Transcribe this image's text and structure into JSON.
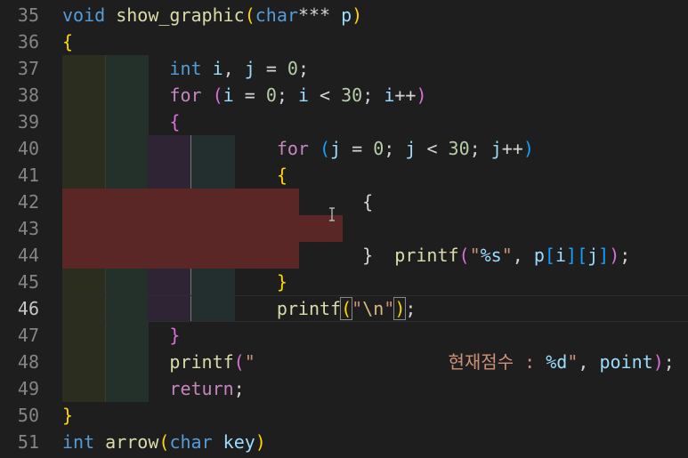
{
  "editor": {
    "active_line": "46",
    "lines": [
      {
        "num": "35",
        "tokens": [
          {
            "t": "void",
            "c": "kw"
          },
          {
            "t": " "
          },
          {
            "t": "show_graphic",
            "c": "fn"
          },
          {
            "t": "(",
            "c": "b1"
          },
          {
            "t": "char",
            "c": "kw"
          },
          {
            "t": "*** "
          },
          {
            "t": "p",
            "c": "var"
          },
          {
            "t": ")",
            "c": "b1"
          }
        ]
      },
      {
        "num": "36",
        "tokens": [
          {
            "t": "{",
            "c": "b1"
          }
        ]
      },
      {
        "num": "37",
        "tokens": [
          {
            "t": "          "
          },
          {
            "t": "int",
            "c": "kw"
          },
          {
            "t": " "
          },
          {
            "t": "i",
            "c": "var"
          },
          {
            "t": ", "
          },
          {
            "t": "j",
            "c": "var"
          },
          {
            "t": " = "
          },
          {
            "t": "0",
            "c": "num"
          },
          {
            "t": ";"
          }
        ]
      },
      {
        "num": "38",
        "tokens": [
          {
            "t": "          "
          },
          {
            "t": "for",
            "c": "ctl"
          },
          {
            "t": " "
          },
          {
            "t": "(",
            "c": "b2"
          },
          {
            "t": "i",
            "c": "var"
          },
          {
            "t": " = "
          },
          {
            "t": "0",
            "c": "num"
          },
          {
            "t": "; "
          },
          {
            "t": "i",
            "c": "var"
          },
          {
            "t": " < "
          },
          {
            "t": "30",
            "c": "num"
          },
          {
            "t": "; "
          },
          {
            "t": "i",
            "c": "var"
          },
          {
            "t": "++"
          },
          {
            "t": ")",
            "c": "b2"
          }
        ]
      },
      {
        "num": "39",
        "tokens": [
          {
            "t": "          "
          },
          {
            "t": "{",
            "c": "b2"
          }
        ]
      },
      {
        "num": "40",
        "tokens": [
          {
            "t": "                    "
          },
          {
            "t": "for",
            "c": "ctl"
          },
          {
            "t": " "
          },
          {
            "t": "(",
            "c": "b3"
          },
          {
            "t": "j",
            "c": "var"
          },
          {
            "t": " = "
          },
          {
            "t": "0",
            "c": "num"
          },
          {
            "t": "; "
          },
          {
            "t": "j",
            "c": "var"
          },
          {
            "t": " < "
          },
          {
            "t": "30",
            "c": "num"
          },
          {
            "t": "; "
          },
          {
            "t": "j",
            "c": "var"
          },
          {
            "t": "++"
          },
          {
            "t": ")",
            "c": "b3"
          }
        ]
      },
      {
        "num": "41",
        "tokens": [
          {
            "t": "                    "
          },
          {
            "t": "{",
            "c": "b1"
          }
        ]
      },
      {
        "num": "42",
        "tokens": [
          {
            "t": "                            "
          },
          {
            "t": "{"
          }
        ]
      },
      {
        "num": "43",
        "tokens": []
      },
      {
        "num": "44",
        "tokens": [
          {
            "t": "                            "
          },
          {
            "t": "}"
          },
          {
            "t": "  "
          },
          {
            "t": "printf",
            "c": "fn"
          },
          {
            "t": "(",
            "c": "b2"
          },
          {
            "t": "\"",
            "c": "str"
          },
          {
            "t": "%s",
            "c": "fmt"
          },
          {
            "t": "\"",
            "c": "str"
          },
          {
            "t": ", "
          },
          {
            "t": "p",
            "c": "var"
          },
          {
            "t": "[",
            "c": "b3"
          },
          {
            "t": "i",
            "c": "var"
          },
          {
            "t": "]",
            "c": "b3"
          },
          {
            "t": "[",
            "c": "b3"
          },
          {
            "t": "j",
            "c": "var"
          },
          {
            "t": "]",
            "c": "b3"
          },
          {
            "t": ")",
            "c": "b2"
          },
          {
            "t": ";"
          }
        ]
      },
      {
        "num": "45",
        "tokens": [
          {
            "t": "                    "
          },
          {
            "t": "}",
            "c": "b1"
          }
        ]
      },
      {
        "num": "46",
        "tokens": [
          {
            "t": "                    "
          },
          {
            "t": "printf",
            "c": "fn"
          },
          {
            "t": "(",
            "c": "b1 bm"
          },
          {
            "t": "\"",
            "c": "str"
          },
          {
            "t": "\\n",
            "c": "esc"
          },
          {
            "t": "\"",
            "c": "str"
          },
          {
            "t": ")",
            "c": "b1 bm"
          },
          {
            "t": ";"
          }
        ]
      },
      {
        "num": "47",
        "tokens": [
          {
            "t": "          "
          },
          {
            "t": "}",
            "c": "b2"
          }
        ]
      },
      {
        "num": "48",
        "tokens": [
          {
            "t": "          "
          },
          {
            "t": "printf",
            "c": "fn"
          },
          {
            "t": "(",
            "c": "b2"
          },
          {
            "t": "\"                  현재점수 : ",
            "c": "str"
          },
          {
            "t": "%d",
            "c": "fmt"
          },
          {
            "t": "\"",
            "c": "str"
          },
          {
            "t": ", "
          },
          {
            "t": "point",
            "c": "var"
          },
          {
            "t": ")",
            "c": "b2"
          },
          {
            "t": ";"
          }
        ]
      },
      {
        "num": "49",
        "tokens": [
          {
            "t": "          "
          },
          {
            "t": "return",
            "c": "ctl"
          },
          {
            "t": ";"
          }
        ]
      },
      {
        "num": "50",
        "tokens": [
          {
            "t": "}",
            "c": "b1"
          }
        ]
      },
      {
        "num": "51",
        "tokens": [
          {
            "t": "int",
            "c": "kw"
          },
          {
            "t": " "
          },
          {
            "t": "arrow",
            "c": "fn"
          },
          {
            "t": "(",
            "c": "b1"
          },
          {
            "t": "char",
            "c": "kw"
          },
          {
            "t": " "
          },
          {
            "t": "key",
            "c": "var"
          },
          {
            "t": ")",
            "c": "b1"
          }
        ]
      }
    ]
  }
}
